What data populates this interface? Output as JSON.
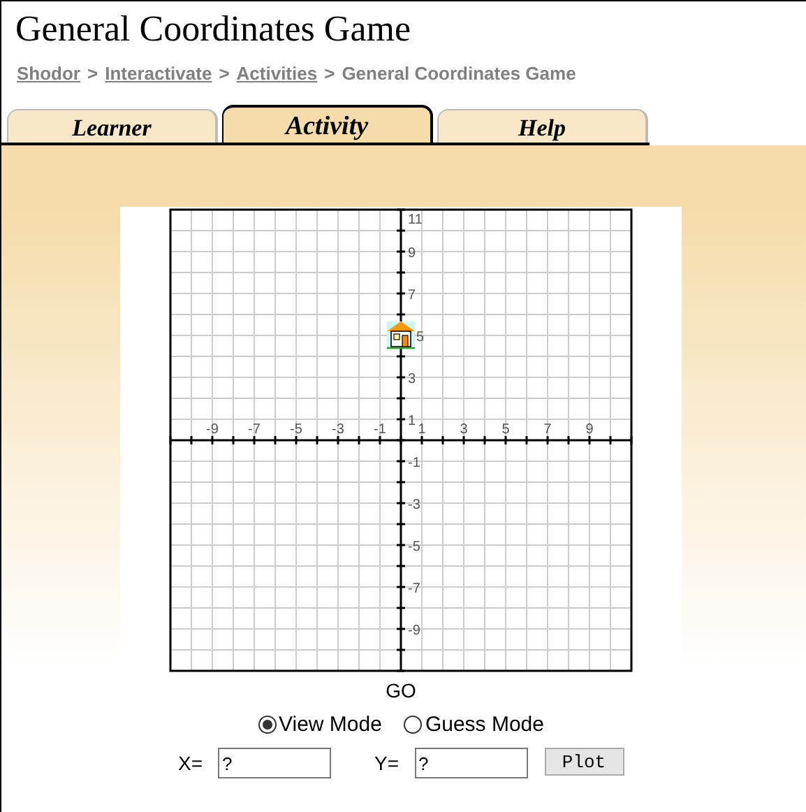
{
  "title": "General Coordinates Game",
  "breadcrumb": [
    {
      "label": "Shodor",
      "link": true
    },
    {
      "label": ">",
      "link": false
    },
    {
      "label": "Interactivate",
      "link": true
    },
    {
      "label": ">",
      "link": false
    },
    {
      "label": "Activities",
      "link": true
    },
    {
      "label": ">",
      "link": false
    },
    {
      "label": "General Coordinates Game",
      "link": false
    }
  ],
  "tabs": [
    {
      "label": "Learner",
      "selected": false
    },
    {
      "label": "Activity",
      "selected": true
    },
    {
      "label": "Help",
      "selected": false
    }
  ],
  "graph": {
    "x_labels": [
      "-9",
      "-7",
      "-5",
      "-3",
      "-1",
      "1",
      "3",
      "5",
      "7",
      "9"
    ],
    "y_labels": [
      {
        "label": "11",
        "house": false
      },
      {
        "label": "9",
        "house": false
      },
      {
        "label": "7",
        "house": false
      },
      {
        "label": "5",
        "house": true
      },
      {
        "label": "3",
        "house": false
      },
      {
        "label": "1",
        "house": false
      },
      {
        "label": "-1",
        "house": false
      },
      {
        "label": "-3",
        "house": false
      },
      {
        "label": "-5",
        "house": false
      },
      {
        "label": "-7",
        "house": false
      },
      {
        "label": "-9",
        "house": false
      }
    ]
  },
  "go_label": "GO",
  "modes": [
    {
      "label": "View Mode",
      "selected": true
    },
    {
      "label": "Guess Mode",
      "selected": false
    }
  ],
  "inputs": [
    {
      "label": "X=",
      "value": "?"
    },
    {
      "label": "Y=",
      "value": "?"
    }
  ],
  "plot_button": "Plot"
}
